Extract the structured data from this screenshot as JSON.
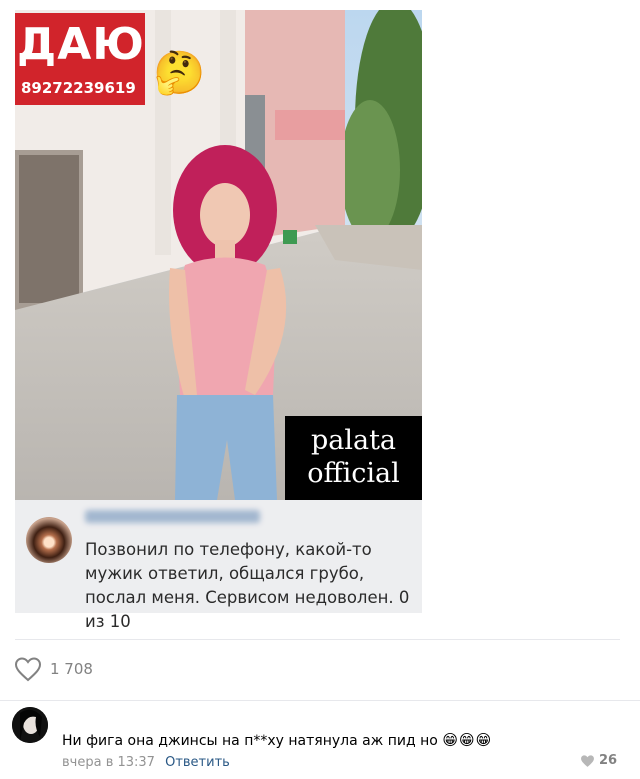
{
  "post": {
    "sign_text": "ДАЮ",
    "sign_phone": "89272239619",
    "sticker_emoji": "🤔",
    "watermark_line1": "palata",
    "watermark_line2": "official",
    "review": {
      "text": "Позвонил по телефону, какой-то мужик ответил, общался грубо, послал меня. Сервисом недоволен. 0 из 10"
    },
    "likes": "1 708",
    "icons": {
      "like": "heart-outline-icon"
    }
  },
  "comment": {
    "text": "Ни фига она джинсы на п**ху натянула аж пид но",
    "emoji": "😁😁😁",
    "time": "вчера в 13:37",
    "reply_label": "Ответить",
    "likes": "26",
    "icons": {
      "like": "heart-filled-icon"
    }
  },
  "colors": {
    "sign_red": "#d1242b",
    "link": "#2a5885",
    "muted": "#939393",
    "review_bg": "#edeef0"
  }
}
